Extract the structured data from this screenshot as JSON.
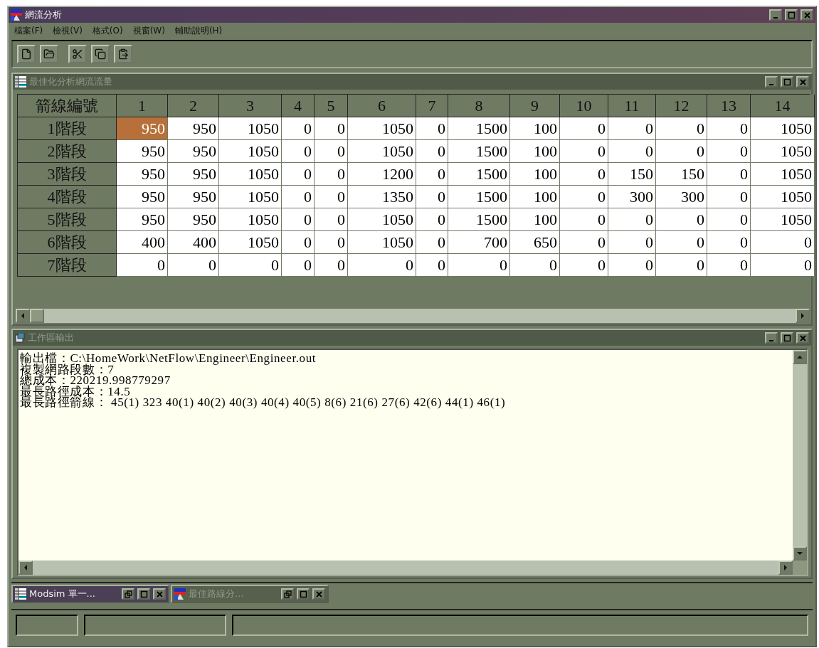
{
  "window": {
    "title": "網流分析"
  },
  "menu": [
    {
      "label": "檔案(F)"
    },
    {
      "label": "檢視(V)"
    },
    {
      "label": "格式(O)"
    },
    {
      "label": "視窗(W)"
    },
    {
      "label": "輔助說明(H)"
    }
  ],
  "toolbar": [
    {
      "kind": "new"
    },
    {
      "kind": "open"
    },
    {
      "kind": "cut"
    },
    {
      "kind": "copy"
    },
    {
      "kind": "paste"
    }
  ],
  "grid_window": {
    "title": "最佳化分析網流流量",
    "active": false,
    "table": {
      "corner": "箭線編號",
      "columns": [
        "1",
        "2",
        "3",
        "4",
        "5",
        "6",
        "7",
        "8",
        "9",
        "10",
        "11",
        "12",
        "13",
        "14"
      ],
      "rows": [
        {
          "label": "1階段",
          "cells": [
            {
              "text": "950",
              "selected": true
            },
            {
              "text": "950",
              "selected": false
            },
            {
              "text": "1050",
              "selected": false
            },
            {
              "text": "0",
              "selected": false
            },
            {
              "text": "0",
              "selected": false
            },
            {
              "text": "1050",
              "selected": false
            },
            {
              "text": "0",
              "selected": false
            },
            {
              "text": "1500",
              "selected": false
            },
            {
              "text": "100",
              "selected": false
            },
            {
              "text": "0",
              "selected": false
            },
            {
              "text": "0",
              "selected": false
            },
            {
              "text": "0",
              "selected": false
            },
            {
              "text": "0",
              "selected": false
            },
            {
              "text": "1050",
              "selected": false
            }
          ]
        },
        {
          "label": "2階段",
          "cells": [
            {
              "text": "950",
              "selected": false
            },
            {
              "text": "950",
              "selected": false
            },
            {
              "text": "1050",
              "selected": false
            },
            {
              "text": "0",
              "selected": false
            },
            {
              "text": "0",
              "selected": false
            },
            {
              "text": "1050",
              "selected": false
            },
            {
              "text": "0",
              "selected": false
            },
            {
              "text": "1500",
              "selected": false
            },
            {
              "text": "100",
              "selected": false
            },
            {
              "text": "0",
              "selected": false
            },
            {
              "text": "0",
              "selected": false
            },
            {
              "text": "0",
              "selected": false
            },
            {
              "text": "0",
              "selected": false
            },
            {
              "text": "1050",
              "selected": false
            }
          ]
        },
        {
          "label": "3階段",
          "cells": [
            {
              "text": "950",
              "selected": false
            },
            {
              "text": "950",
              "selected": false
            },
            {
              "text": "1050",
              "selected": false
            },
            {
              "text": "0",
              "selected": false
            },
            {
              "text": "0",
              "selected": false
            },
            {
              "text": "1200",
              "selected": false
            },
            {
              "text": "0",
              "selected": false
            },
            {
              "text": "1500",
              "selected": false
            },
            {
              "text": "100",
              "selected": false
            },
            {
              "text": "0",
              "selected": false
            },
            {
              "text": "150",
              "selected": false
            },
            {
              "text": "150",
              "selected": false
            },
            {
              "text": "0",
              "selected": false
            },
            {
              "text": "1050",
              "selected": false
            }
          ]
        },
        {
          "label": "4階段",
          "cells": [
            {
              "text": "950",
              "selected": false
            },
            {
              "text": "950",
              "selected": false
            },
            {
              "text": "1050",
              "selected": false
            },
            {
              "text": "0",
              "selected": false
            },
            {
              "text": "0",
              "selected": false
            },
            {
              "text": "1350",
              "selected": false
            },
            {
              "text": "0",
              "selected": false
            },
            {
              "text": "1500",
              "selected": false
            },
            {
              "text": "100",
              "selected": false
            },
            {
              "text": "0",
              "selected": false
            },
            {
              "text": "300",
              "selected": false
            },
            {
              "text": "300",
              "selected": false
            },
            {
              "text": "0",
              "selected": false
            },
            {
              "text": "1050",
              "selected": false
            }
          ]
        },
        {
          "label": "5階段",
          "cells": [
            {
              "text": "950",
              "selected": false
            },
            {
              "text": "950",
              "selected": false
            },
            {
              "text": "1050",
              "selected": false
            },
            {
              "text": "0",
              "selected": false
            },
            {
              "text": "0",
              "selected": false
            },
            {
              "text": "1050",
              "selected": false
            },
            {
              "text": "0",
              "selected": false
            },
            {
              "text": "1500",
              "selected": false
            },
            {
              "text": "100",
              "selected": false
            },
            {
              "text": "0",
              "selected": false
            },
            {
              "text": "0",
              "selected": false
            },
            {
              "text": "0",
              "selected": false
            },
            {
              "text": "0",
              "selected": false
            },
            {
              "text": "1050",
              "selected": false
            }
          ]
        },
        {
          "label": "6階段",
          "cells": [
            {
              "text": "400",
              "selected": false
            },
            {
              "text": "400",
              "selected": false
            },
            {
              "text": "1050",
              "selected": false
            },
            {
              "text": "0",
              "selected": false
            },
            {
              "text": "0",
              "selected": false
            },
            {
              "text": "1050",
              "selected": false
            },
            {
              "text": "0",
              "selected": false
            },
            {
              "text": "700",
              "selected": false
            },
            {
              "text": "650",
              "selected": false
            },
            {
              "text": "0",
              "selected": false
            },
            {
              "text": "0",
              "selected": false
            },
            {
              "text": "0",
              "selected": false
            },
            {
              "text": "0",
              "selected": false
            },
            {
              "text": "0",
              "selected": false
            }
          ]
        },
        {
          "label": "7階段",
          "cells": [
            {
              "text": "0",
              "selected": false
            },
            {
              "text": "0",
              "selected": false
            },
            {
              "text": "0",
              "selected": false
            },
            {
              "text": "0",
              "selected": false
            },
            {
              "text": "0",
              "selected": false
            },
            {
              "text": "0",
              "selected": false
            },
            {
              "text": "0",
              "selected": false
            },
            {
              "text": "0",
              "selected": false
            },
            {
              "text": "0",
              "selected": false
            },
            {
              "text": "0",
              "selected": false
            },
            {
              "text": "0",
              "selected": false
            },
            {
              "text": "0",
              "selected": false
            },
            {
              "text": "0",
              "selected": false
            },
            {
              "text": "0",
              "selected": false
            }
          ]
        }
      ]
    }
  },
  "output_window": {
    "title": "工作區輸出",
    "active": false,
    "lines": [
      "輸出檔：C:\\HomeWork\\NetFlow\\Engineer\\Engineer.out",
      "複製網路段數：7",
      "總成本：220219.998779297",
      "最長路徑成本：14.5",
      "最長路徑箭線： 45(1) 323 40(1) 40(2) 40(3) 40(4) 40(5) 8(6) 21(6) 27(6) 42(6) 44(1) 46(1)"
    ]
  },
  "minimized_windows": [
    {
      "title": "Modsim 單一...",
      "active": true,
      "kind": "table"
    },
    {
      "title": "最佳路線分...",
      "active": false,
      "kind": "app"
    }
  ]
}
